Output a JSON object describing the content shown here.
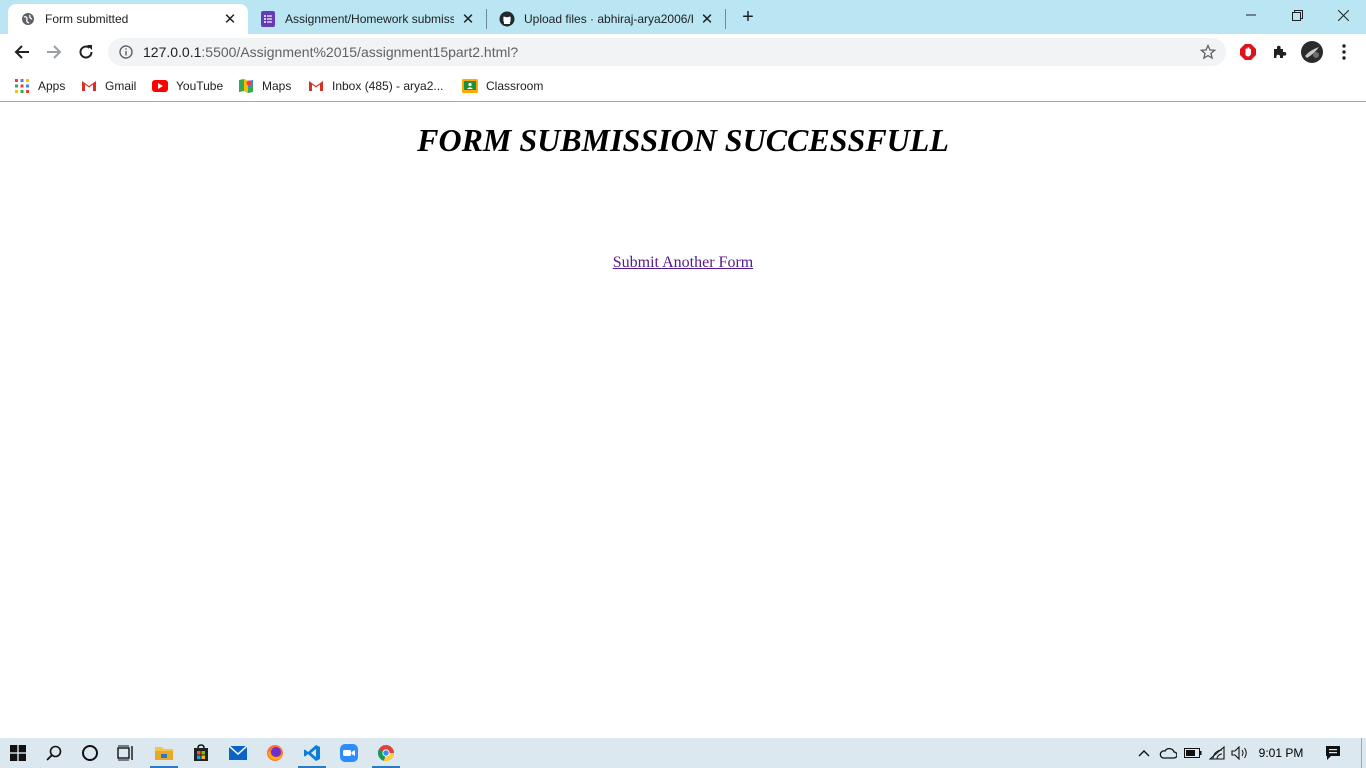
{
  "browser": {
    "tabs": [
      {
        "title": "Form submitted",
        "icon": "globe-icon",
        "active": true
      },
      {
        "title": "Assignment/Homework submissio",
        "icon": "google-forms-icon",
        "active": false
      },
      {
        "title": "Upload files · abhiraj-arya2006/H",
        "icon": "github-icon",
        "active": false
      }
    ],
    "address": {
      "host": "127.0.0.1",
      "rest": ":5500/Assignment%2015/assignment15part2.html?"
    },
    "bookmarks": [
      {
        "label": "Apps",
        "icon": "apps-grid-icon"
      },
      {
        "label": "Gmail",
        "icon": "gmail-icon"
      },
      {
        "label": "YouTube",
        "icon": "youtube-icon"
      },
      {
        "label": "Maps",
        "icon": "maps-icon"
      },
      {
        "label": "Inbox (485) - arya2...",
        "icon": "gmail-icon"
      },
      {
        "label": "Classroom",
        "icon": "classroom-icon"
      }
    ]
  },
  "page": {
    "heading": "FORM SUBMISSION SUCCESSFULL",
    "link_text": "Submit Another Form"
  },
  "taskbar": {
    "clock": "9:01 PM"
  },
  "colors": {
    "tabstrip": "#b9e6f2",
    "visited_link": "#551a8b",
    "taskbar": "#dbe8ef"
  }
}
